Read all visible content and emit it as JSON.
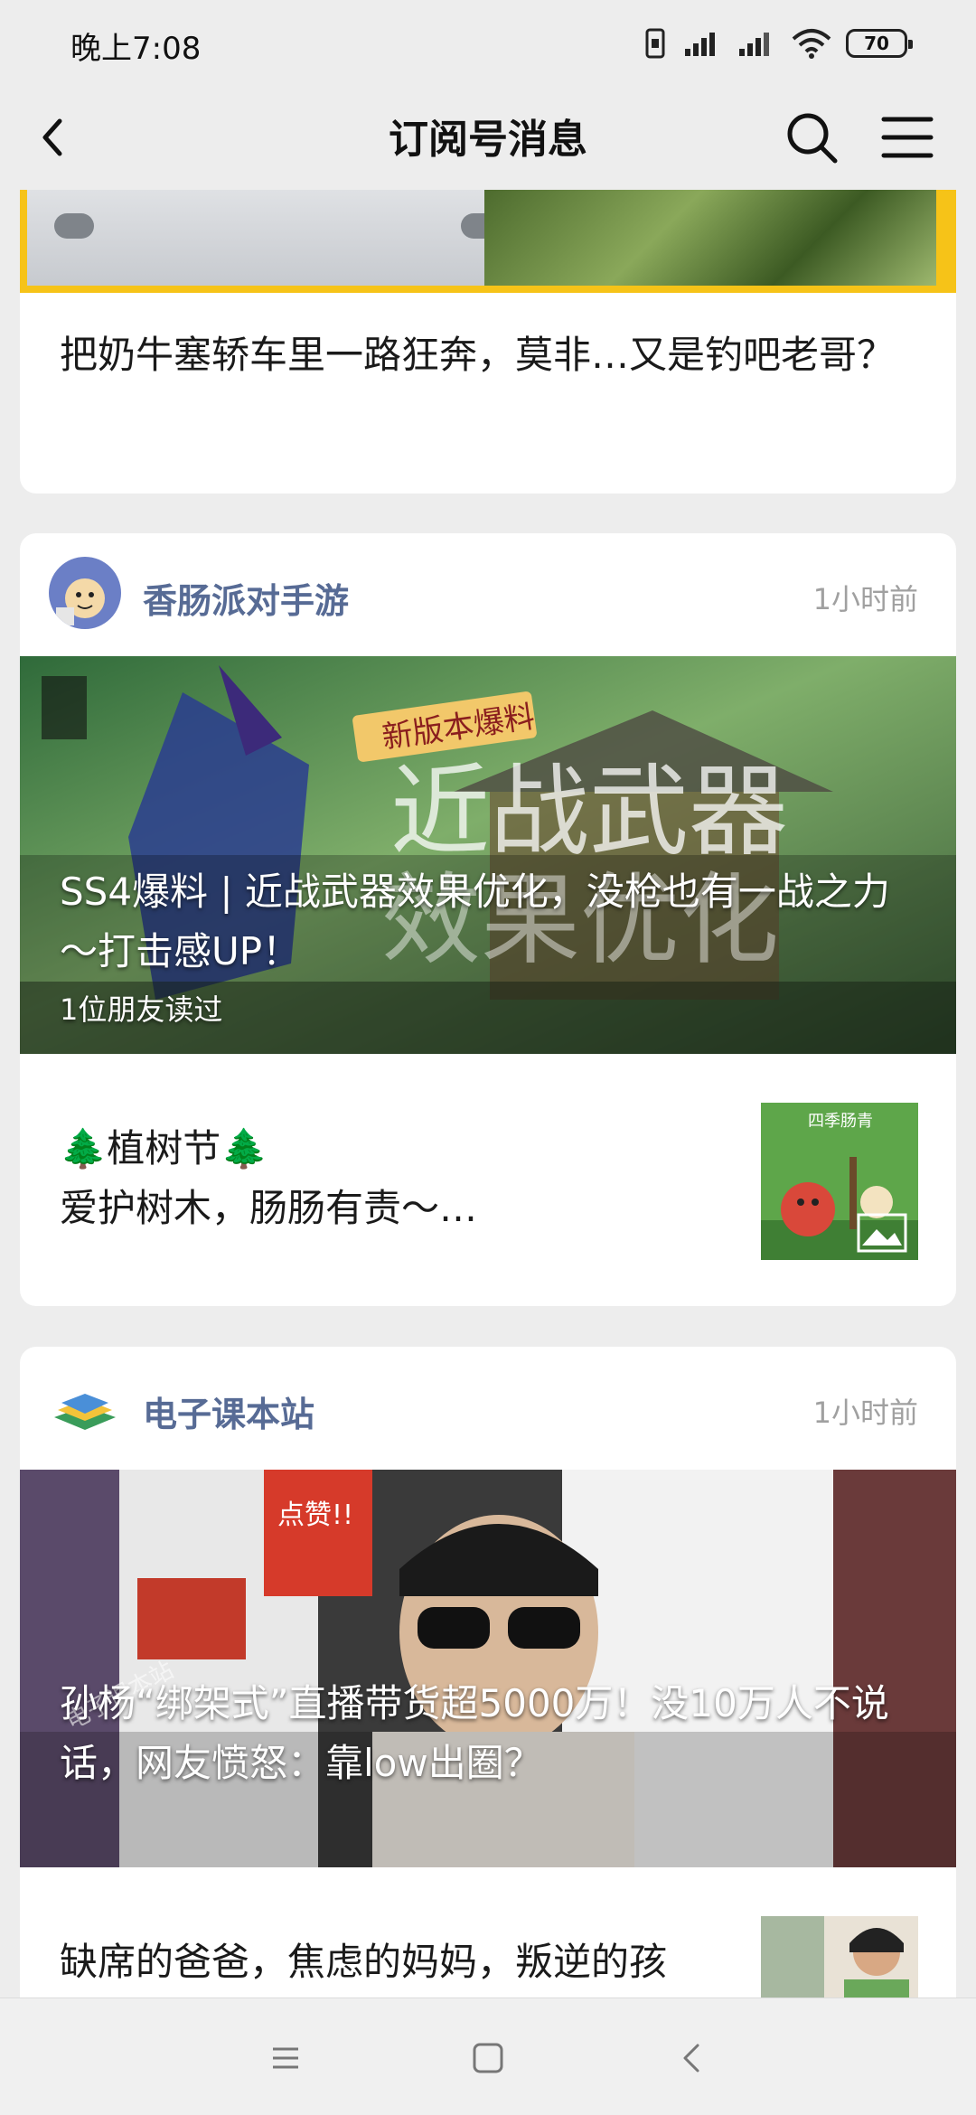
{
  "status_bar": {
    "time": "晚上7:08",
    "battery": "70"
  },
  "nav": {
    "title": "订阅号消息"
  },
  "card1": {
    "headline": "把奶牛塞轿车里一路狂奔，莫非…又是钓吧老哥？"
  },
  "card2": {
    "account": "香肠派对手游",
    "time": "1小时前",
    "cover_title": "SS4爆料 | 近战武器效果优化，没枪也有一战之力～打击感UP！",
    "cover_sub": "1位朋友读过",
    "cover_art_text": [
      "新版本爆料",
      "近战武器",
      "效果优化"
    ],
    "item": {
      "line1": "🌲植树节🌲",
      "line2": "爱护树木，肠肠有责～…",
      "thumb_label": "四季肠青"
    }
  },
  "card3": {
    "account": "电子课本站",
    "time": "1小时前",
    "cover_title": "孙杨“绑架式”直播带货超5000万！没10万人不说话，网友愤怒：靠low出圈？",
    "cover_art_text": [
      "点赞!!",
      "电子课本站"
    ],
    "item": {
      "line1": "缺席的爸爸，焦虑的妈妈，叛逆的孩"
    }
  },
  "icons": {
    "back": "chevron-left-icon",
    "search": "search-icon",
    "menu": "hamburger-menu-icon",
    "image": "image-icon"
  },
  "colors": {
    "account_name": "#576b95",
    "time": "#a0a0a0",
    "background": "#ededed",
    "accent_yellow": "#f6c318"
  }
}
